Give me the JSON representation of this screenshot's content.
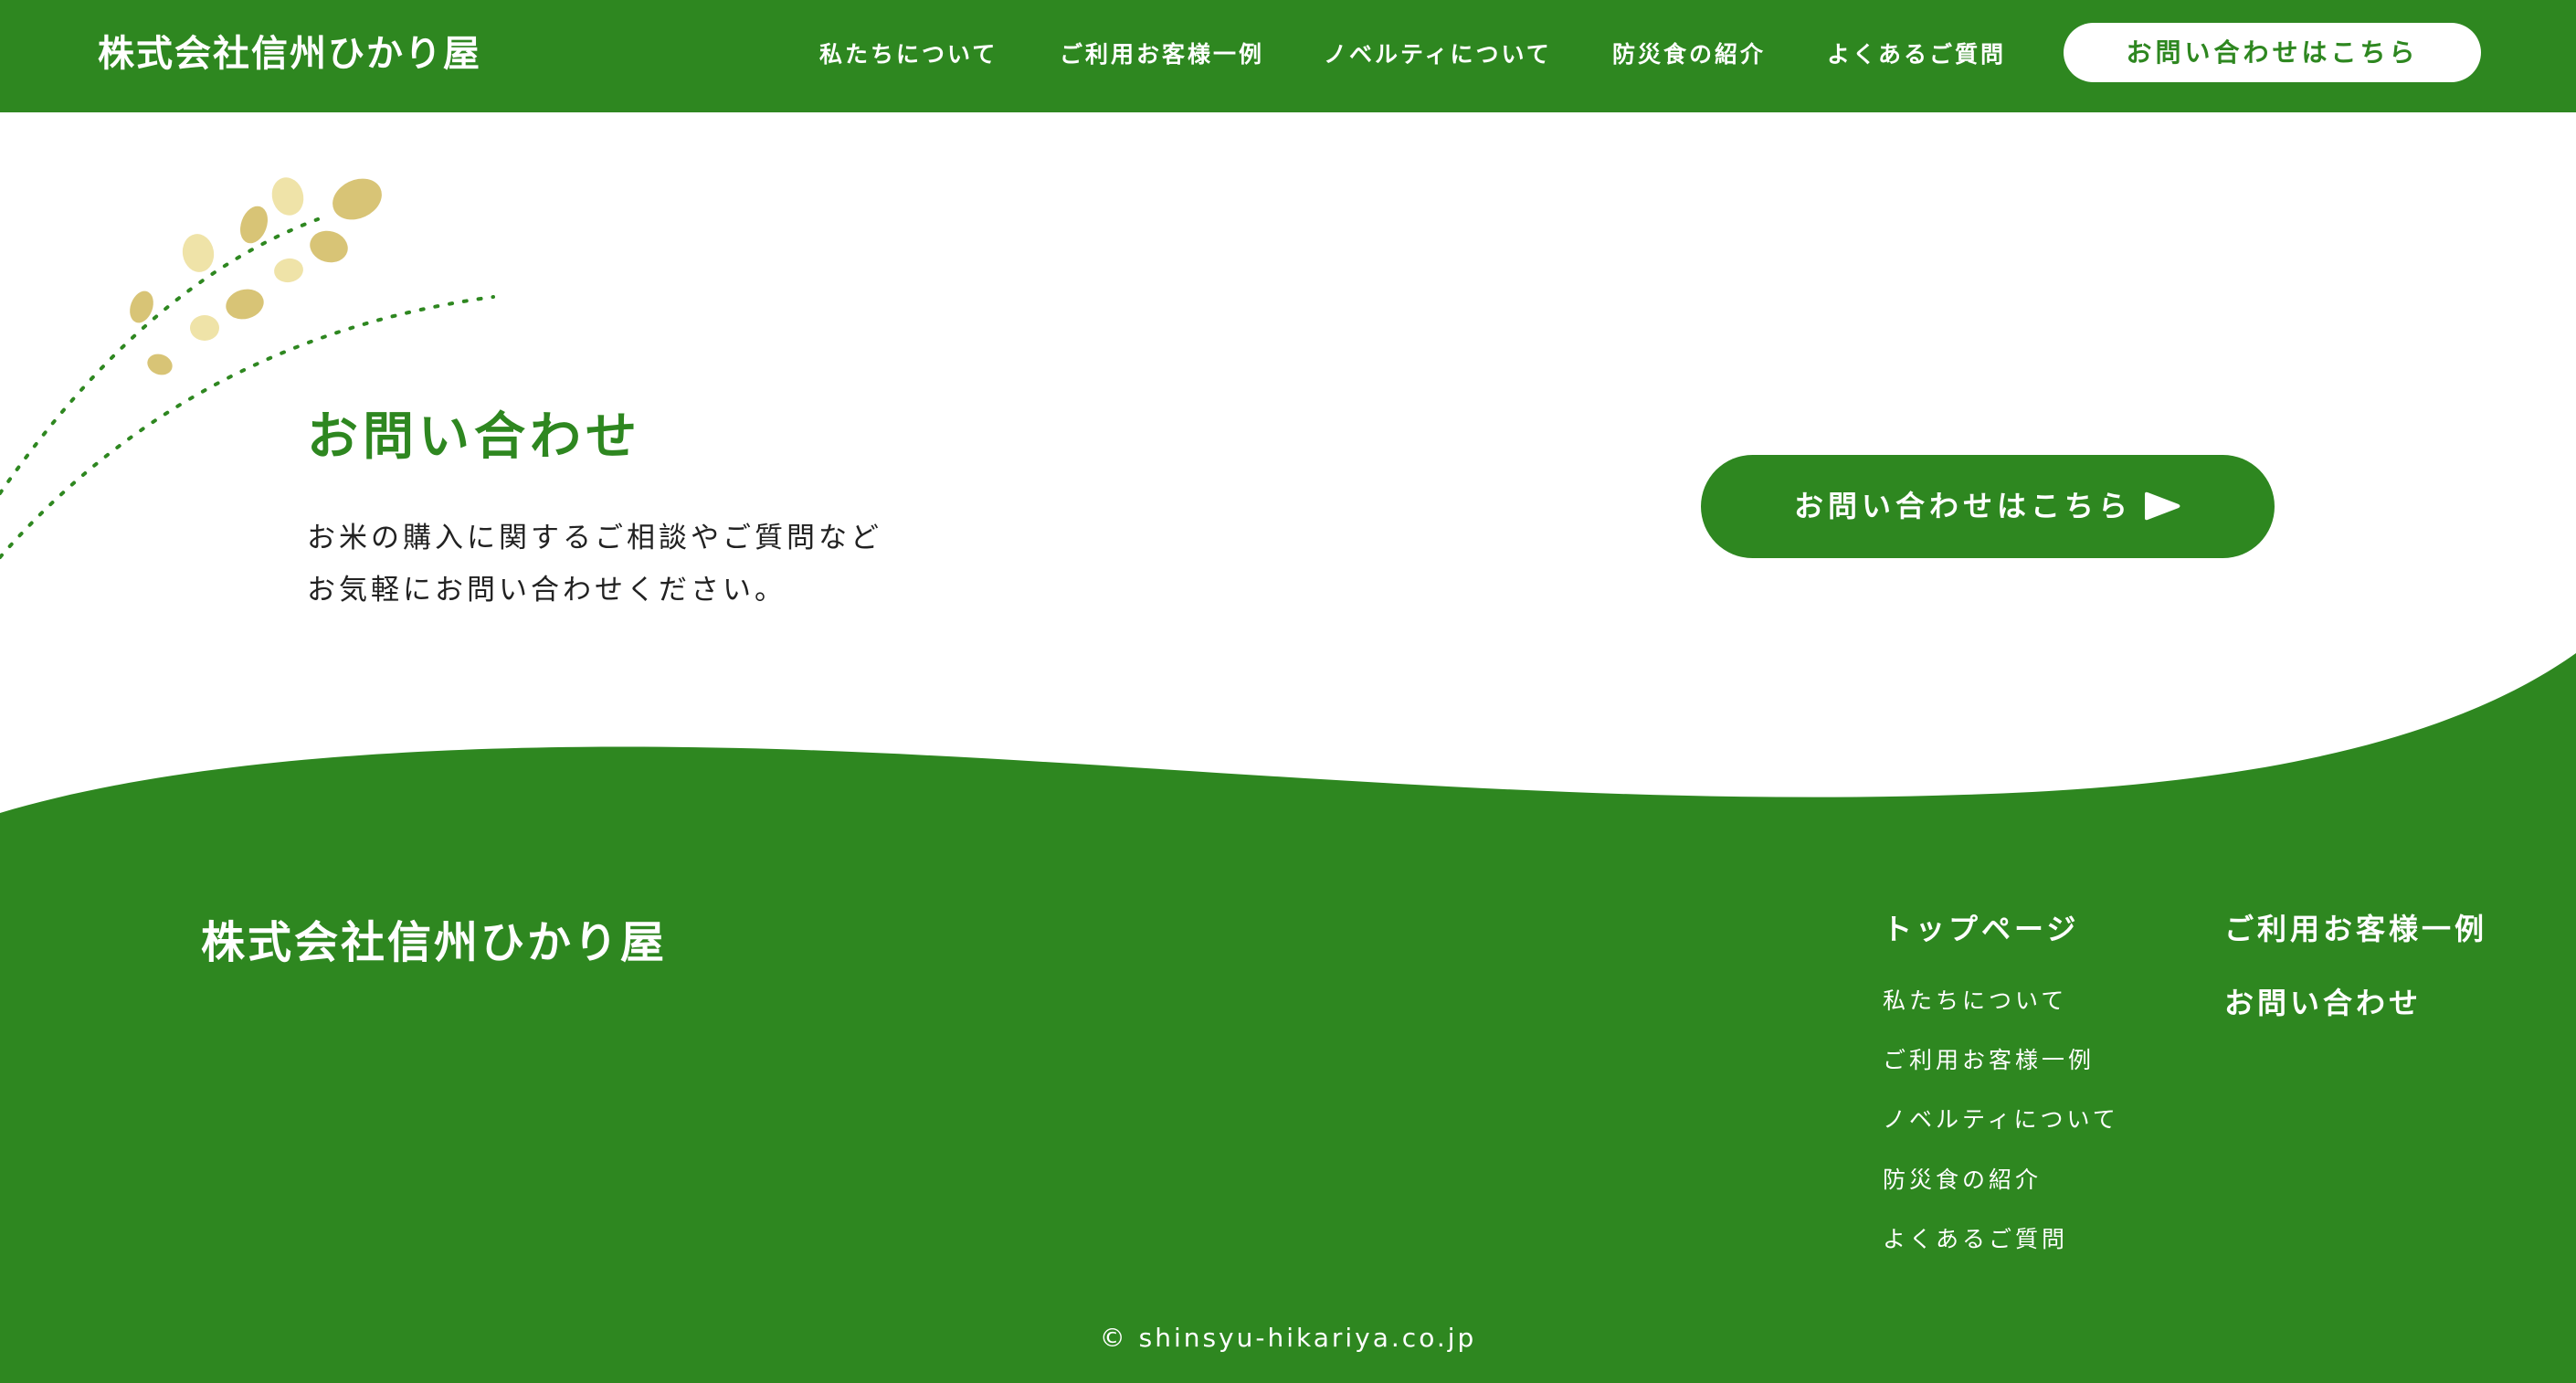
{
  "colors": {
    "brand_green": "#2e8720",
    "white": "#ffffff",
    "rice_gold": "#d8c476",
    "rice_pale": "#efe3a8"
  },
  "header": {
    "logo": "株式会社信州ひかり屋",
    "nav": [
      {
        "label": "私たちについて"
      },
      {
        "label": "ご利用お客様一例"
      },
      {
        "label": "ノベルティについて"
      },
      {
        "label": "防災食の紹介"
      },
      {
        "label": "よくあるご質問"
      }
    ],
    "cta": "お問い合わせはこちら"
  },
  "decoration": {
    "icon": "rice-ear-icon"
  },
  "contact": {
    "title": "お問い合わせ",
    "text_line1": "お米の購入に関するご相談やご質問など",
    "text_line2": "お気軽にお問い合わせください。",
    "button_label": "お問い合わせはこちら",
    "button_icon": "play-arrow-icon"
  },
  "footer": {
    "logo": "株式会社信州ひかり屋",
    "col1_heading": "トップページ",
    "col1_links": [
      {
        "label": "私たちについて"
      },
      {
        "label": "ご利用お客様一例"
      },
      {
        "label": "ノベルティについて"
      },
      {
        "label": "防災食の紹介"
      },
      {
        "label": "よくあるご質問"
      }
    ],
    "col2_heading": "ご利用お客様一例",
    "col2_contact": "お問い合わせ",
    "copyright": "© shinsyu-hikariya.co.jp"
  }
}
